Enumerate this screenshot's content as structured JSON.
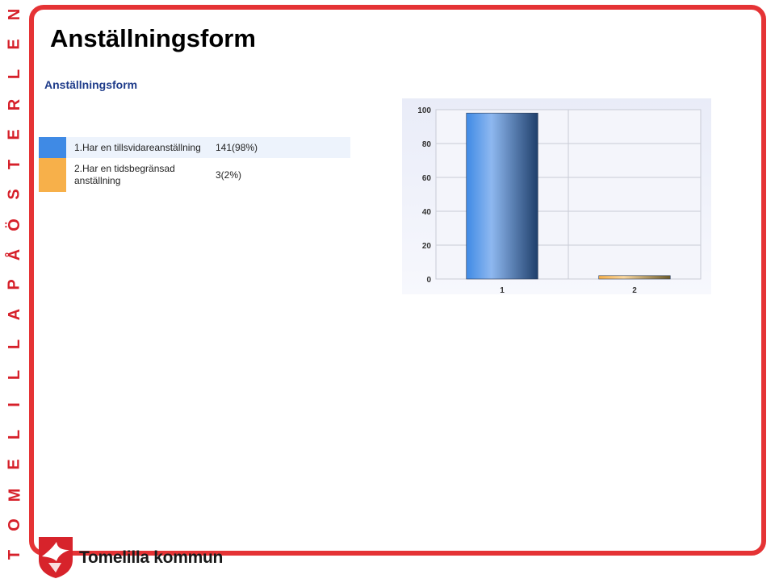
{
  "sidebar_text": [
    "T",
    "O",
    "M",
    "E",
    "L",
    "I",
    "L",
    "L",
    "A",
    "P",
    "Å",
    "Ö",
    "S",
    "T",
    "E",
    "R",
    "L",
    "E",
    "N"
  ],
  "title": "Anställningsform",
  "subtitle": "Anställningsform",
  "legend": [
    {
      "label": "1.Har en tillsvidareanställning",
      "value": "141(98%)",
      "color": "#3f8ae5"
    },
    {
      "label": "2.Har en tidsbegränsad anställning",
      "value": "3(2%)",
      "color": "#f7b04a"
    }
  ],
  "brand_name": "Tomelilla kommun",
  "chart_data": {
    "type": "bar",
    "categories": [
      "1",
      "2"
    ],
    "values": [
      141,
      3
    ],
    "display_values": [
      98,
      2
    ],
    "ylim": [
      0,
      100
    ],
    "yticks": [
      "0",
      "20",
      "40",
      "60",
      "80",
      "100"
    ],
    "grid": true,
    "colors": [
      "#3f8ae5",
      "#f7b04a"
    ]
  }
}
